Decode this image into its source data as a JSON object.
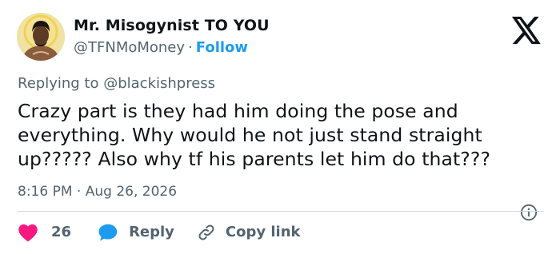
{
  "author": {
    "display_name": "Mr. Misogynist TO YOU",
    "handle": "@TFNMoMoney",
    "separator": "·",
    "follow_label": "Follow"
  },
  "reply_context": {
    "prefix": "Replying to",
    "handle": "@blackishpress"
  },
  "tweet": {
    "text": "Crazy part is they had him doing the pose and everything. Why would he not just stand straight up????? Also why tf his parents let him do that???"
  },
  "meta": {
    "time": "8:16 PM",
    "separator": "·",
    "date": "Aug 26, 2026"
  },
  "actions": {
    "like_count": "26",
    "reply_label": "Reply",
    "copy_link_label": "Copy link"
  },
  "colors": {
    "accent": "#1d9bf0",
    "like": "#f91880",
    "text": "#0f1419",
    "secondary": "#536471",
    "divider": "#cfd9de"
  },
  "icons": [
    "x-logo-icon",
    "info-icon",
    "heart-icon",
    "reply-bubble-icon",
    "link-icon"
  ]
}
